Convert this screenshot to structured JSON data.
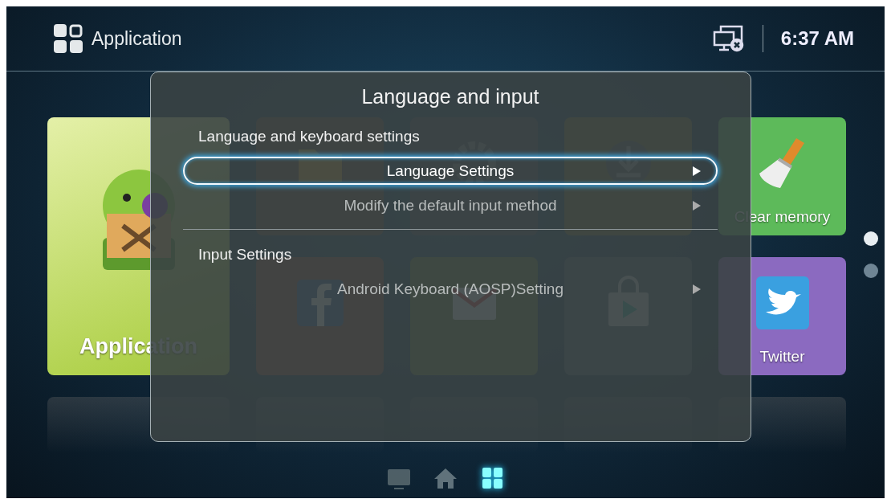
{
  "header": {
    "title": "Application",
    "time": "6:37 AM"
  },
  "tiles": [
    {
      "kind": "android",
      "label": "Application"
    },
    {
      "kind": "folder"
    },
    {
      "kind": "gear"
    },
    {
      "kind": "download"
    },
    {
      "kind": "broom",
      "label": "Clear memory"
    },
    {
      "kind": "facebook"
    },
    {
      "kind": "mail"
    },
    {
      "kind": "store"
    },
    {
      "kind": "bird",
      "label": "Twitter"
    }
  ],
  "dialog": {
    "title": "Language and input",
    "sections": [
      {
        "heading": "Language and keyboard settings",
        "items": [
          {
            "label": "Language Settings",
            "selected": true
          },
          {
            "label": "Modify the default input method",
            "selected": false
          }
        ]
      },
      {
        "heading": "Input Settings",
        "items": [
          {
            "label": "Android Keyboard (AOSP)Setting",
            "selected": false
          }
        ]
      }
    ]
  },
  "page_dots": [
    {
      "selected": true
    },
    {
      "selected": false
    }
  ],
  "bottom_nav": [
    {
      "kind": "tv",
      "selected": false
    },
    {
      "kind": "home",
      "selected": false
    },
    {
      "kind": "apps",
      "selected": true
    }
  ]
}
